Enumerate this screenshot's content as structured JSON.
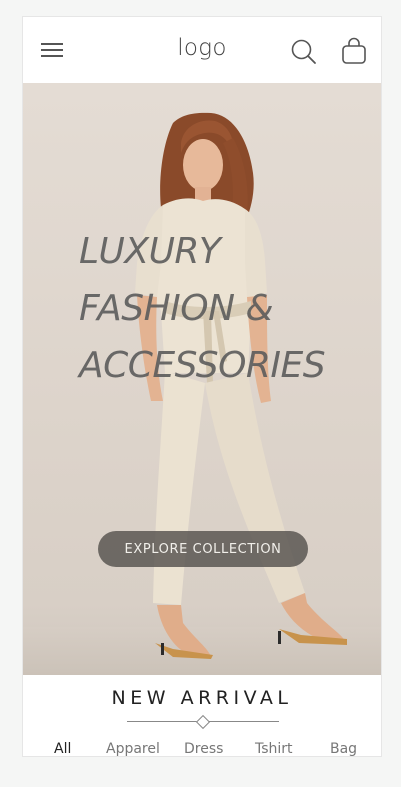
{
  "header": {
    "logo": "logo",
    "menu_icon": "hamburger-menu-icon",
    "search_icon": "search-icon",
    "bag_icon": "shopping-bag-icon"
  },
  "hero": {
    "headline_lines": [
      "LUXURY",
      "FASHION &",
      "ACCESSORIES"
    ],
    "cta_label": "EXPLORE COLLECTION"
  },
  "new_arrival": {
    "title": "NEW ARRIVAL",
    "tabs": [
      {
        "label": "All",
        "active": true
      },
      {
        "label": "Apparel",
        "active": false
      },
      {
        "label": "Dress",
        "active": false
      },
      {
        "label": "Tshirt",
        "active": false
      },
      {
        "label": "Bag",
        "active": false
      }
    ]
  },
  "colors": {
    "background": "#f5f6f5",
    "surface": "#ffffff",
    "hero_bg": "#e0d8cf",
    "headline_text": "#5c5c5c",
    "cta_bg": "#55524e",
    "cta_text": "#f1efea",
    "title_text": "#222222",
    "muted_text": "#777777"
  }
}
